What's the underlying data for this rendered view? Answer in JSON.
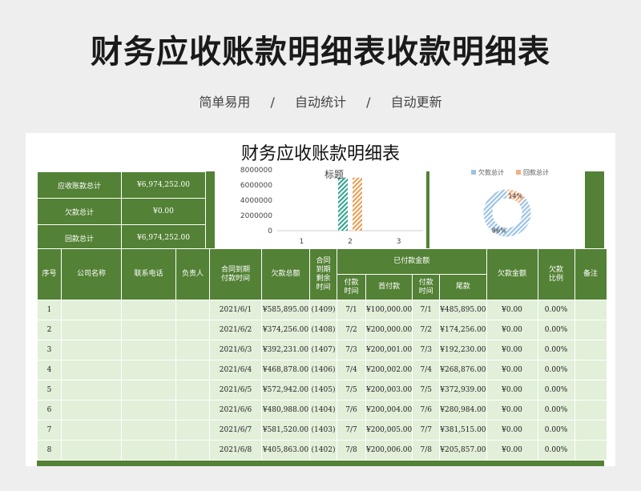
{
  "hero": {
    "title": "财务应收账款明细表收款明细表"
  },
  "subtitle": {
    "items": [
      "简单易用",
      "/",
      "自动统计",
      "/",
      "自动更新"
    ]
  },
  "sheet": {
    "title": "财务应收账款明细表"
  },
  "summary": [
    {
      "label": "应收账款总计",
      "value": "¥6,974,252.00"
    },
    {
      "label": "欠款总计",
      "value": "¥0.00"
    },
    {
      "label": "回款总计",
      "value": "¥6,974,252.00"
    }
  ],
  "headers": {
    "seq": "序号",
    "company": "公司名称",
    "phone": "联系电话",
    "owner": "负责人",
    "due": [
      "合同到期",
      "付款时间"
    ],
    "total": "欠款总额",
    "remain": [
      "合同",
      "到期",
      "剩余",
      "时间"
    ],
    "paid_group": "已付款金额",
    "pay_time": [
      "付款",
      "时间"
    ],
    "first": "首付款",
    "tail": "尾款",
    "owed": "欠款金额",
    "ratio": [
      "欠款",
      "比例"
    ],
    "note": "备注"
  },
  "rows": [
    {
      "seq": "1",
      "due": "2021/6/1",
      "total": "¥585,895.00",
      "remain": "(1409)",
      "t1": "7/1",
      "first": "¥100,000.00",
      "t2": "7/1",
      "tail": "¥485,895.00",
      "owed": "¥0.00",
      "ratio": "0.00%"
    },
    {
      "seq": "2",
      "due": "2021/6/2",
      "total": "¥374,256.00",
      "remain": "(1408)",
      "t1": "7/2",
      "first": "¥200,000.00",
      "t2": "7/2",
      "tail": "¥174,256.00",
      "owed": "¥0.00",
      "ratio": "0.00%"
    },
    {
      "seq": "3",
      "due": "2021/6/3",
      "total": "¥392,231.00",
      "remain": "(1407)",
      "t1": "7/3",
      "first": "¥200,001.00",
      "t2": "7/3",
      "tail": "¥192,230.00",
      "owed": "¥0.00",
      "ratio": "0.00%"
    },
    {
      "seq": "4",
      "due": "2021/6/4",
      "total": "¥468,878.00",
      "remain": "(1406)",
      "t1": "7/4",
      "first": "¥200,002.00",
      "t2": "7/4",
      "tail": "¥268,876.00",
      "owed": "¥0.00",
      "ratio": "0.00%"
    },
    {
      "seq": "5",
      "due": "2021/6/5",
      "total": "¥572,942.00",
      "remain": "(1405)",
      "t1": "7/5",
      "first": "¥200,003.00",
      "t2": "7/5",
      "tail": "¥372,939.00",
      "owed": "¥0.00",
      "ratio": "0.00%"
    },
    {
      "seq": "6",
      "due": "2021/6/6",
      "total": "¥480,988.00",
      "remain": "(1404)",
      "t1": "7/6",
      "first": "¥200,004.00",
      "t2": "7/6",
      "tail": "¥280,984.00",
      "owed": "¥0.00",
      "ratio": "0.00%"
    },
    {
      "seq": "7",
      "due": "2021/6/7",
      "total": "¥581,520.00",
      "remain": "(1403)",
      "t1": "7/7",
      "first": "¥200,005.00",
      "t2": "7/7",
      "tail": "¥381,515.00",
      "owed": "¥0.00",
      "ratio": "0.00%"
    },
    {
      "seq": "8",
      "due": "2021/6/8",
      "total": "¥405,863.00",
      "remain": "(1402)",
      "t1": "7/8",
      "first": "¥200,006.00",
      "t2": "7/8",
      "tail": "¥205,857.00",
      "owed": "¥0.00",
      "ratio": "0.00%"
    }
  ],
  "chart_data": [
    {
      "type": "bar",
      "title": "标题",
      "categories": [
        "1",
        "2",
        "3"
      ],
      "series": [
        {
          "values": [
            0,
            6974252,
            0
          ],
          "color": "#2ca58d"
        },
        {
          "values": [
            0,
            6974252,
            0
          ],
          "color": "#ed9a4f"
        }
      ],
      "ylim": [
        0,
        8000000
      ],
      "yticks": [
        "8000000",
        "6000000",
        "4000000",
        "2000000",
        "0"
      ]
    },
    {
      "type": "pie",
      "series": [
        {
          "name": "欠款总计",
          "color": "#9dc3e6"
        },
        {
          "name": "回款总计",
          "color": "#f4b183"
        }
      ],
      "values": [
        86,
        14
      ],
      "labels": [
        "86%",
        "14%"
      ],
      "legend": "top"
    }
  ]
}
